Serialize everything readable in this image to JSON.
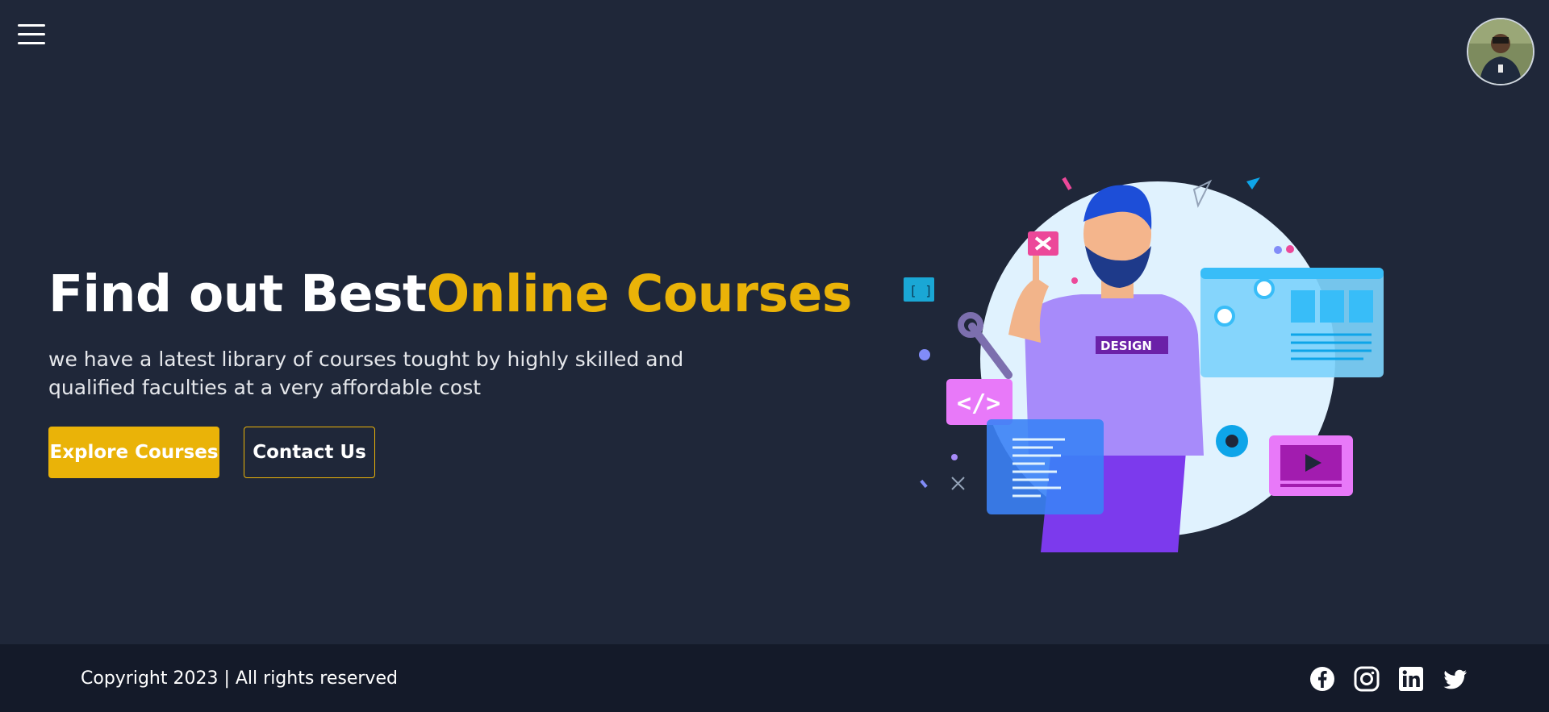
{
  "header": {
    "menu_icon": "hamburger-menu-icon",
    "avatar_icon": "user-avatar"
  },
  "hero": {
    "title_part1": "Find out Best",
    "title_part2": "Online Courses",
    "description": "we have a latest library of courses tought by highly skilled and qualified faculties at a very affordable cost",
    "primary_button": "Explore Courses",
    "secondary_button": "Contact Us",
    "illustration_label": "DESIGN"
  },
  "footer": {
    "copyright": "Copyright 2023 | All rights reserved",
    "social_icons": [
      "facebook-icon",
      "instagram-icon",
      "linkedin-icon",
      "twitter-icon"
    ]
  },
  "colors": {
    "background": "#1f2739",
    "footer_bg": "#141a29",
    "accent": "#eab308",
    "text": "#ffffff"
  }
}
